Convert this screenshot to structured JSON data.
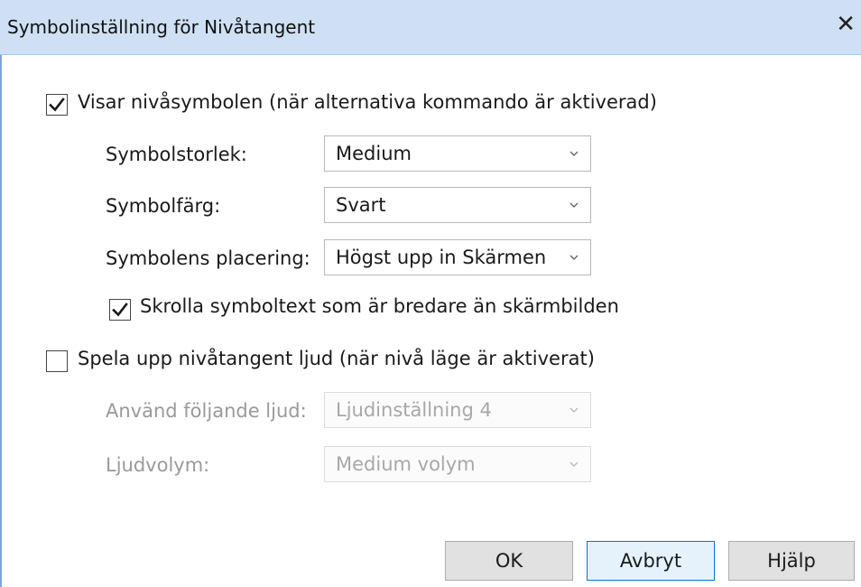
{
  "dialog": {
    "title": "Symbolinställning för Nivåtangent",
    "close_glyph": "✕"
  },
  "show_symbol": {
    "checked": true,
    "label": "Visar nivåsymbolen (när alternativa kommando är aktiverad)"
  },
  "symbol_size": {
    "label": "Symbolstorlek:",
    "value": "Medium"
  },
  "symbol_color": {
    "label": "Symbolfärg:",
    "value": "Svart"
  },
  "symbol_position": {
    "label": "Symbolens placering:",
    "value": "Högst upp in Skärmen"
  },
  "scroll_text": {
    "checked": true,
    "label": "Skrolla symboltext som är bredare än skärmbilden"
  },
  "play_sound": {
    "checked": false,
    "label": "Spela upp nivåtangent ljud (när nivå läge är aktiverat)"
  },
  "sound_select": {
    "label": "Använd följande ljud:",
    "value": "Ljudinställning 4",
    "disabled": true
  },
  "volume_select": {
    "label": "Ljudvolym:",
    "value": "Medium volym",
    "disabled": true
  },
  "buttons": {
    "ok": "OK",
    "cancel": "Avbryt",
    "help": "Hjälp"
  },
  "colors": {
    "titlebar": "#cfe0f5",
    "focus_border": "#0078d7",
    "disabled_text": "#9a9a9a"
  },
  "icons": {
    "close": "close-icon",
    "checkmark": "checkmark-icon",
    "dropdown": "chevron-down-icon"
  }
}
